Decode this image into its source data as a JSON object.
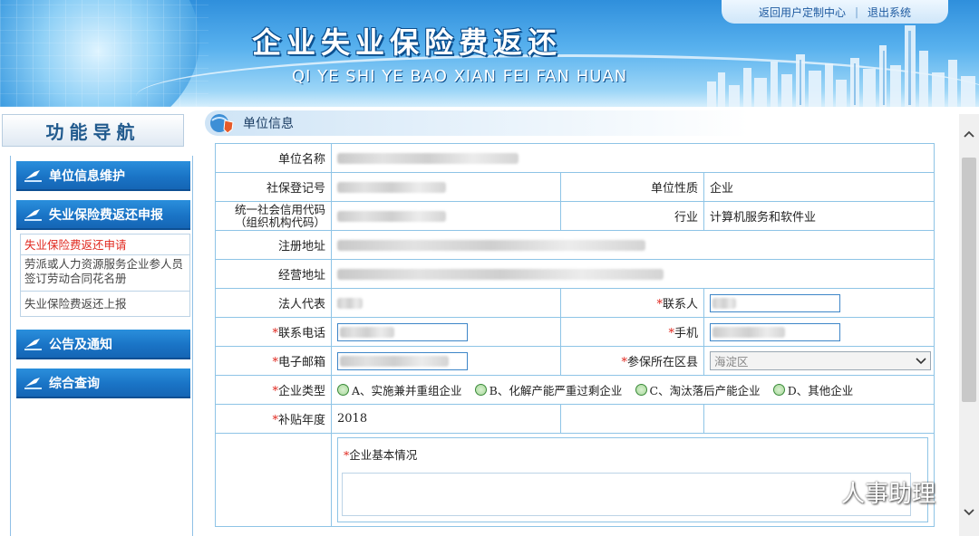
{
  "header": {
    "title_cn": "企业失业保险费返还",
    "title_pinyin": "QI YE SHI YE BAO XIAN FEI FAN HUAN",
    "links": {
      "back": "返回用户定制中心",
      "exit": "退出系统"
    }
  },
  "sidebar": {
    "title": "功能导航",
    "menu": [
      {
        "label": "单位信息维护"
      },
      {
        "label": "失业保险费返还申报"
      },
      {
        "label": "公告及通知"
      },
      {
        "label": "综合查询"
      }
    ],
    "sub_items": [
      {
        "label": "失业保险费返还申请",
        "active": true
      },
      {
        "label": "劳派或人力资源服务企业参人员签订劳动合同花名册",
        "active": false
      },
      {
        "label": "失业保险费返还上报",
        "active": false
      }
    ]
  },
  "section": {
    "title": "单位信息"
  },
  "form": {
    "labels": {
      "unit_name": "单位名称",
      "social_security_no": "社保登记号",
      "unit_nature": "单位性质",
      "credit_code_line1": "统一社会信用代码",
      "credit_code_line2": "（组织机构代码）",
      "industry": "行业",
      "reg_address": "注册地址",
      "op_address": "经营地址",
      "legal_rep": "法人代表",
      "contact": "联系人",
      "phone": "联系电话",
      "mobile": "手机",
      "email": "电子邮箱",
      "district": "参保所在区县",
      "enterprise_type": "企业类型",
      "subsidy_year": "补贴年度",
      "basic_info": "企业基本情况"
    },
    "required_mark": "*",
    "values": {
      "unit_nature": "企业",
      "industry": "计算机服务和软件业",
      "district": "海淀区",
      "subsidy_year": "2018"
    },
    "enterprise_types": [
      "A、实施兼并重组企业",
      "B、化解产能严重过剩企业",
      "C、淘汰落后产能企业",
      "D、其他企业"
    ]
  },
  "watermark": {
    "text": "人事助理"
  }
}
